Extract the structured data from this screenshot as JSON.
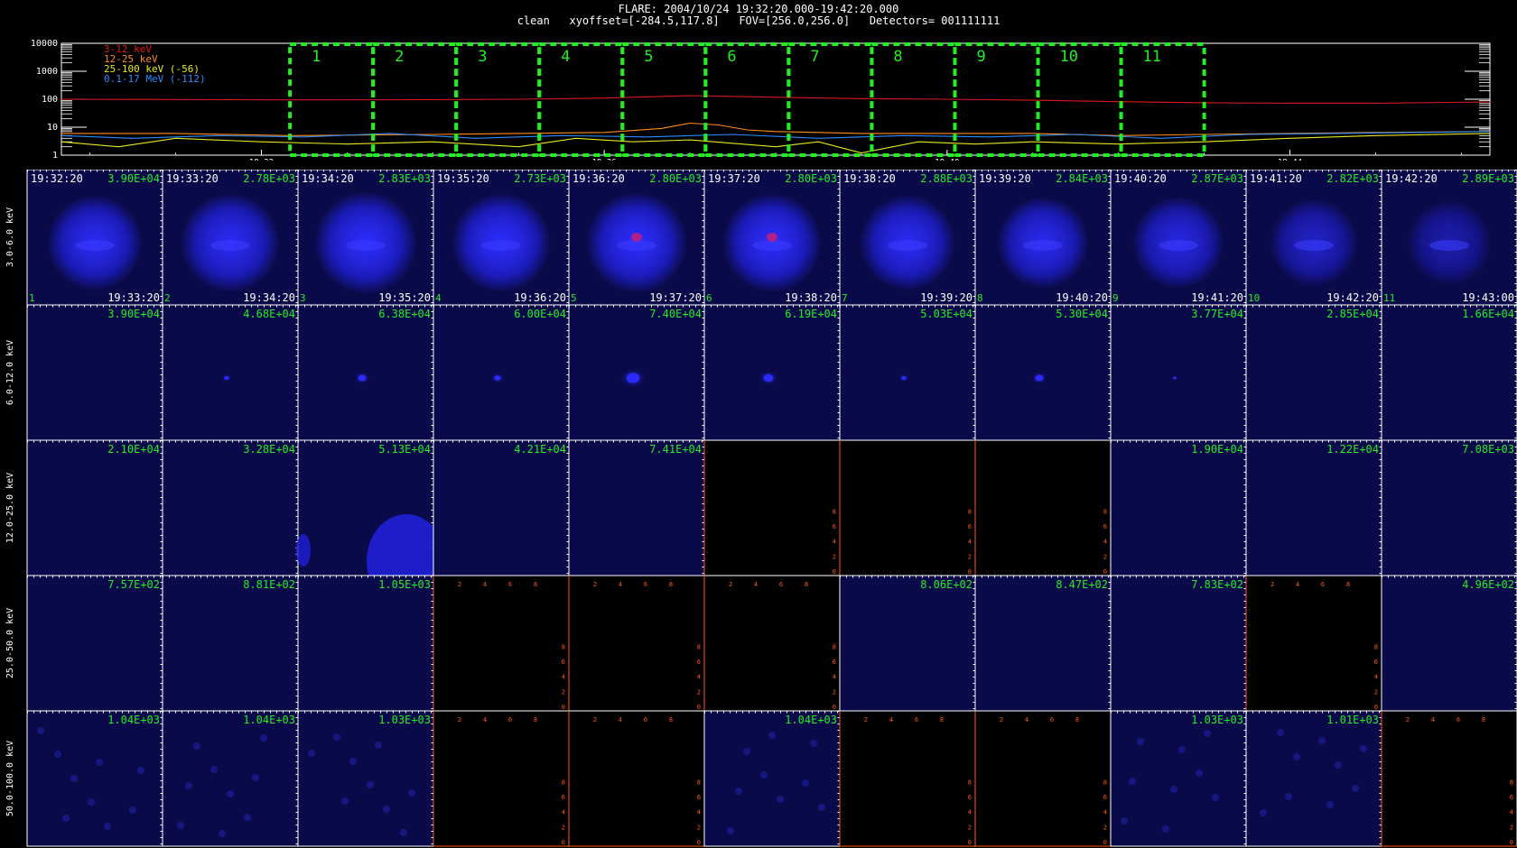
{
  "header": {
    "line1": "FLARE: 2004/10/24 19:32:20.000-19:42:20.000",
    "line2": "clean   xyoffset=[-284.5,117.8]   FOV=[256.0,256.0]   Detectors= 001111111"
  },
  "chart_data": [
    {
      "type": "line",
      "ylog": true,
      "ylim": [
        1,
        10000
      ],
      "xlim": [
        "19:29:40",
        "19:46:20"
      ],
      "yticks": [
        "1",
        "10",
        "100",
        "1000",
        "10000"
      ],
      "xticks": [
        "19:32",
        "19:36",
        "19:40",
        "19:44"
      ],
      "legend": [
        "3-12 keV",
        "12-25 keV",
        "25-100 keV (-56)",
        "0.1-17 MeV (-112)"
      ],
      "series": [
        {
          "name": "3-12 keV",
          "color": "#e01818",
          "points": [
            [
              "19:29:40",
              100
            ],
            [
              "19:31:00",
              98
            ],
            [
              "19:32:20",
              95
            ],
            [
              "19:34:00",
              96
            ],
            [
              "19:35:00",
              100
            ],
            [
              "19:36:00",
              110
            ],
            [
              "19:37:00",
              135
            ],
            [
              "19:38:00",
              118
            ],
            [
              "19:39:00",
              105
            ],
            [
              "19:40:00",
              100
            ],
            [
              "19:41:00",
              92
            ],
            [
              "19:42:00",
              82
            ],
            [
              "19:43:00",
              75
            ],
            [
              "19:44:00",
              72
            ],
            [
              "19:45:00",
              72
            ],
            [
              "19:46:20",
              80
            ]
          ]
        },
        {
          "name": "12-25 keV",
          "color": "#ff8c1a",
          "points": [
            [
              "19:29:40",
              6
            ],
            [
              "19:31:00",
              6
            ],
            [
              "19:32:20",
              5
            ],
            [
              "19:34:00",
              5.5
            ],
            [
              "19:35:00",
              6
            ],
            [
              "19:36:00",
              6.5
            ],
            [
              "19:36:40",
              9
            ],
            [
              "19:37:00",
              14
            ],
            [
              "19:37:20",
              12
            ],
            [
              "19:37:40",
              8
            ],
            [
              "19:38:00",
              7
            ],
            [
              "19:39:00",
              6
            ],
            [
              "19:40:00",
              6
            ],
            [
              "19:41:00",
              6
            ],
            [
              "19:42:00",
              5
            ],
            [
              "19:43:00",
              5.5
            ],
            [
              "19:44:00",
              6
            ],
            [
              "19:45:00",
              6.5
            ],
            [
              "19:46:20",
              7
            ]
          ]
        },
        {
          "name": "25-100 keV (-56)",
          "color": "#e8e820",
          "points": [
            [
              "19:29:40",
              3
            ],
            [
              "19:30:20",
              2
            ],
            [
              "19:31:00",
              4
            ],
            [
              "19:32:00",
              3
            ],
            [
              "19:33:00",
              2.5
            ],
            [
              "19:34:00",
              3
            ],
            [
              "19:35:00",
              2
            ],
            [
              "19:35:40",
              4
            ],
            [
              "19:36:20",
              3
            ],
            [
              "19:37:00",
              3.5
            ],
            [
              "19:38:00",
              2
            ],
            [
              "19:38:30",
              3
            ],
            [
              "19:39:00",
              1.2
            ],
            [
              "19:39:40",
              3
            ],
            [
              "19:40:20",
              2.5
            ],
            [
              "19:41:00",
              3
            ],
            [
              "19:42:00",
              2.5
            ],
            [
              "19:43:00",
              3
            ],
            [
              "19:44:00",
              4
            ],
            [
              "19:45:00",
              5
            ],
            [
              "19:46:20",
              6
            ]
          ]
        },
        {
          "name": "0.1-17 MeV (-112)",
          "color": "#2a8cff",
          "points": [
            [
              "19:29:40",
              5
            ],
            [
              "19:30:30",
              4
            ],
            [
              "19:31:30",
              5
            ],
            [
              "19:32:30",
              4.5
            ],
            [
              "19:33:30",
              6
            ],
            [
              "19:34:30",
              4
            ],
            [
              "19:35:30",
              5
            ],
            [
              "19:36:30",
              4.5
            ],
            [
              "19:37:30",
              5.5
            ],
            [
              "19:38:30",
              4
            ],
            [
              "19:39:30",
              5
            ],
            [
              "19:40:30",
              4.5
            ],
            [
              "19:41:30",
              5.5
            ],
            [
              "19:42:30",
              4
            ],
            [
              "19:43:30",
              5.5
            ],
            [
              "19:44:30",
              6
            ],
            [
              "19:45:30",
              6.5
            ],
            [
              "19:46:20",
              7
            ]
          ]
        }
      ],
      "intervals": [
        "1",
        "2",
        "3",
        "4",
        "5",
        "6",
        "7",
        "8",
        "9",
        "10",
        "11"
      ],
      "interval_range": [
        "19:32:20",
        "19:43:00"
      ]
    },
    {
      "type": "heatmap",
      "row_labels": [
        "3.0-6.0 keV",
        "6.0-12.0 keV",
        "12.0-25.0 keV",
        "25.0-50.0 keV",
        "50.0-100.0 keV"
      ],
      "time_labels": [
        "19:32:20",
        "19:33:20",
        "19:34:20",
        "19:35:20",
        "19:36:20",
        "19:37:20",
        "19:38:20",
        "19:39:20",
        "19:40:20",
        "19:41:20",
        "19:42:20"
      ],
      "end_labels": [
        "19:33:20",
        "19:34:20",
        "19:35:20",
        "19:36:20",
        "19:37:20",
        "19:38:20",
        "19:39:20",
        "19:40:20",
        "19:41:20",
        "19:42:20",
        "19:43:00"
      ],
      "index_labels": [
        "1",
        "2",
        "3",
        "4",
        "5",
        "6",
        "7",
        "8",
        "9",
        "10",
        "11"
      ],
      "max_values": [
        [
          "3.90E+04",
          "2.78E+03",
          "2.83E+03",
          "2.73E+03",
          "2.80E+03",
          "2.80E+03",
          "2.88E+03",
          "2.84E+03",
          "2.87E+03",
          "2.82E+03",
          "2.89E+03"
        ],
        [
          "3.90E+04",
          "4.68E+04",
          "6.38E+04",
          "6.00E+04",
          "7.40E+04",
          "6.19E+04",
          "5.03E+04",
          "5.30E+04",
          "3.77E+04",
          "2.85E+04",
          "1.66E+04"
        ],
        [
          "2.10E+04",
          "3.28E+04",
          "5.13E+04",
          "4.21E+04",
          "7.41E+04",
          "",
          "",
          "",
          "1.90E+04",
          "1.22E+04",
          "7.08E+03"
        ],
        [
          "7.57E+02",
          "8.81E+02",
          "1.05E+03",
          "",
          "",
          "",
          "8.06E+02",
          "8.47E+02",
          "7.83E+02",
          "",
          "4.96E+02"
        ],
        [
          "1.04E+03",
          "1.04E+03",
          "1.03E+03",
          "",
          "",
          "1.04E+03",
          "",
          "",
          "1.03E+03",
          "1.01E+03",
          ""
        ]
      ],
      "empty_axis_ticks_y": [
        "0",
        "2",
        "4",
        "6",
        "8"
      ],
      "empty_axis_ticks_x": [
        "2",
        "4",
        "6",
        "8"
      ]
    }
  ]
}
